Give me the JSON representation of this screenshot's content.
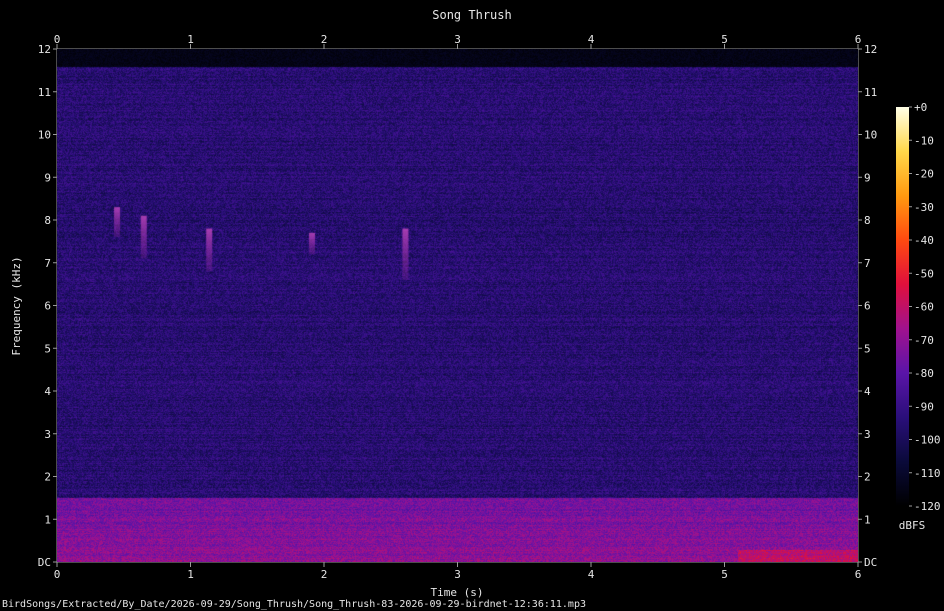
{
  "chart_data": {
    "type": "heatmap",
    "title": "Song Thrush",
    "xlabel": "Time (s)",
    "ylabel": "Frequency (kHz)",
    "xlim": [
      0,
      6
    ],
    "ylim": [
      0,
      12
    ],
    "x_ticks": [
      "0",
      "1",
      "2",
      "3",
      "4",
      "5",
      "6"
    ],
    "y_ticks": [
      "DC",
      "1",
      "2",
      "3",
      "4",
      "5",
      "6",
      "7",
      "8",
      "9",
      "10",
      "11",
      "12"
    ],
    "colorbar": {
      "label": "dBFS",
      "range": [
        -120,
        0
      ],
      "ticks": [
        "+0",
        "-10",
        "-20",
        "-30",
        "-40",
        "-50",
        "-60",
        "-70",
        "-80",
        "-90",
        "-100",
        "-110",
        "-120"
      ],
      "colors": [
        "#000000",
        "#0a0a3a",
        "#2a0f7a",
        "#5a14a8",
        "#a0128e",
        "#e0103c",
        "#ff4a10",
        "#ff9a10",
        "#ffd84a",
        "#ffffe8"
      ]
    },
    "noise_floor": {
      "low_band_khz": [
        0,
        1.5
      ],
      "low_band_dbfs": -70,
      "high_band_dbfs": -95,
      "quiet_above_khz": 11.6
    },
    "calls": [
      {
        "t": 0.45,
        "f_low": 7.6,
        "f_high": 8.3
      },
      {
        "t": 0.65,
        "f_low": 7.1,
        "f_high": 8.1
      },
      {
        "t": 1.14,
        "f_low": 6.8,
        "f_high": 7.8
      },
      {
        "t": 1.91,
        "f_low": 7.2,
        "f_high": 7.7
      },
      {
        "t": 2.61,
        "f_low": 6.6,
        "f_high": 7.8
      }
    ]
  },
  "footer": {
    "filename": "BirdSongs/Extracted/By_Date/2026-09-29/Song_Thrush/Song_Thrush-83-2026-09-29-birdnet-12:36:11.mp3"
  }
}
